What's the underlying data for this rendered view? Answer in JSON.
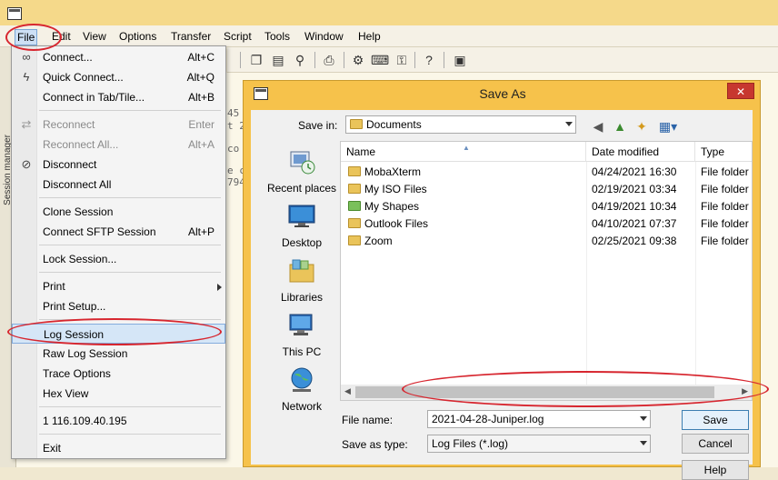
{
  "menubar": {
    "items": [
      "File",
      "Edit",
      "View",
      "Options",
      "Transfer",
      "Script",
      "Tools",
      "Window",
      "Help"
    ]
  },
  "sidebar": {
    "strip_label": "Session manager"
  },
  "terminal": {
    "fragments": [
      "45",
      "t 2",
      "co",
      "e c",
      "794"
    ]
  },
  "file_menu": {
    "items": [
      {
        "label": "Connect...",
        "shortcut": "Alt+C",
        "icon": "link-icon",
        "disabled": false
      },
      {
        "label": "Quick Connect...",
        "shortcut": "Alt+Q",
        "icon": "lightning-icon",
        "disabled": false
      },
      {
        "label": "Connect in Tab/Tile...",
        "shortcut": "Alt+B",
        "icon": "",
        "disabled": false
      },
      {
        "label": "Reconnect",
        "shortcut": "Enter",
        "icon": "reconnect-icon",
        "disabled": true
      },
      {
        "label": "Reconnect All...",
        "shortcut": "Alt+A",
        "icon": "",
        "disabled": true
      },
      {
        "label": "Disconnect",
        "shortcut": "",
        "icon": "disconnect-icon",
        "disabled": false
      },
      {
        "label": "Disconnect All",
        "shortcut": "",
        "icon": "",
        "disabled": false
      },
      {
        "label": "Clone Session",
        "shortcut": "",
        "icon": "",
        "disabled": false
      },
      {
        "label": "Connect SFTP Session",
        "shortcut": "Alt+P",
        "icon": "",
        "disabled": false
      },
      {
        "label": "Lock Session...",
        "shortcut": "",
        "icon": "",
        "disabled": false
      },
      {
        "label": "Print",
        "shortcut": "",
        "icon": "",
        "disabled": false,
        "submenu": true
      },
      {
        "label": "Print Setup...",
        "shortcut": "",
        "icon": "",
        "disabled": false
      },
      {
        "label": "Log Session",
        "shortcut": "",
        "icon": "",
        "disabled": false,
        "highlighted": true
      },
      {
        "label": "Raw Log Session",
        "shortcut": "",
        "icon": "",
        "disabled": false
      },
      {
        "label": "Trace Options",
        "shortcut": "",
        "icon": "",
        "disabled": false
      },
      {
        "label": "Hex View",
        "shortcut": "",
        "icon": "",
        "disabled": false
      },
      {
        "label": "1 116.109.40.195",
        "shortcut": "",
        "icon": "",
        "disabled": false
      },
      {
        "label": "Exit",
        "shortcut": "",
        "icon": "",
        "disabled": false
      }
    ]
  },
  "dialog": {
    "title": "Save As",
    "close_label": "✕",
    "save_in_label": "Save in:",
    "save_in_value": "Documents",
    "places": [
      "Recent places",
      "Desktop",
      "Libraries",
      "This PC",
      "Network"
    ],
    "columns": [
      "Name",
      "Date modified",
      "Type"
    ],
    "files": [
      {
        "name": "MobaXterm",
        "date": "04/24/2021 16:30",
        "type": "File folder"
      },
      {
        "name": "My ISO Files",
        "date": "02/19/2021 03:34",
        "type": "File folder"
      },
      {
        "name": "My Shapes",
        "date": "04/19/2021 10:34",
        "type": "File folder"
      },
      {
        "name": "Outlook Files",
        "date": "04/10/2021 07:37",
        "type": "File folder"
      },
      {
        "name": "Zoom",
        "date": "02/25/2021 09:38",
        "type": "File folder"
      }
    ],
    "file_name_label": "File name:",
    "file_name_value": "2021-04-28-Juniper.log",
    "save_type_label": "Save as type:",
    "save_type_value": "Log Files (*.log)",
    "save_button": "Save",
    "cancel_button": "Cancel",
    "help_button": "Help"
  },
  "colors": {
    "title_bar": "#f5d98a",
    "dialog_frame": "#f6c24b",
    "annotation": "#d7262f",
    "close_button": "#c7372f"
  }
}
